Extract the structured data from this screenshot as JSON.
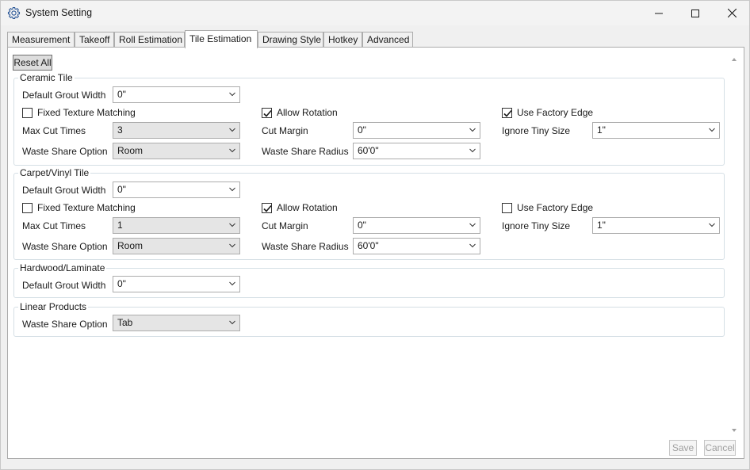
{
  "window": {
    "title": "System Setting"
  },
  "tabs": [
    "Measurement",
    "Takeoff",
    "Roll Estimation",
    "Tile Estimation",
    "Drawing Style",
    "Hotkey",
    "Advanced"
  ],
  "active_tab": "Tile Estimation",
  "reset_all": "Reset All",
  "ceramic": {
    "title": "Ceramic Tile",
    "default_grout_width_label": "Default Grout Width",
    "default_grout_width": "0\"",
    "fixed_texture_label": "Fixed Texture Matching",
    "fixed_texture_checked": false,
    "allow_rotation_label": "Allow Rotation",
    "allow_rotation_checked": true,
    "use_factory_edge_label": "Use Factory Edge",
    "use_factory_edge_checked": true,
    "max_cut_times_label": "Max Cut Times",
    "max_cut_times": "3",
    "cut_margin_label": "Cut Margin",
    "cut_margin": "0\"",
    "ignore_tiny_size_label": "Ignore Tiny Size",
    "ignore_tiny_size": "1\"",
    "waste_share_option_label": "Waste Share Option",
    "waste_share_option": "Room",
    "waste_share_radius_label": "Waste Share Radius",
    "waste_share_radius": "60'0\""
  },
  "carpet": {
    "title": "Carpet/Vinyl Tile",
    "default_grout_width_label": "Default Grout Width",
    "default_grout_width": "0\"",
    "fixed_texture_label": "Fixed Texture Matching",
    "fixed_texture_checked": false,
    "allow_rotation_label": "Allow Rotation",
    "allow_rotation_checked": true,
    "use_factory_edge_label": "Use Factory Edge",
    "use_factory_edge_checked": false,
    "max_cut_times_label": "Max Cut Times",
    "max_cut_times": "1",
    "cut_margin_label": "Cut Margin",
    "cut_margin": "0\"",
    "ignore_tiny_size_label": "Ignore Tiny Size",
    "ignore_tiny_size": "1\"",
    "waste_share_option_label": "Waste Share Option",
    "waste_share_option": "Room",
    "waste_share_radius_label": "Waste Share Radius",
    "waste_share_radius": "60'0\""
  },
  "hardwood": {
    "title": "Hardwood/Laminate",
    "default_grout_width_label": "Default Grout Width",
    "default_grout_width": "0\""
  },
  "linear": {
    "title": "Linear Products",
    "waste_share_option_label": "Waste Share Option",
    "waste_share_option": "Tab"
  },
  "footer": {
    "save": "Save",
    "cancel": "Cancel"
  }
}
